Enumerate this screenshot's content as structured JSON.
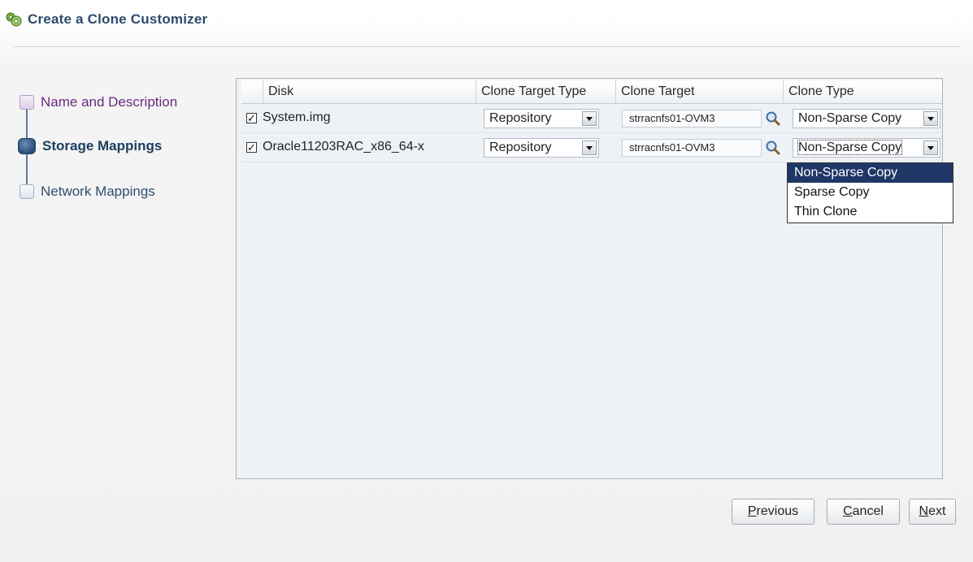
{
  "dialog": {
    "title": "Create a Clone Customizer"
  },
  "train": {
    "steps": [
      {
        "label": "Name and Description",
        "state": "visited"
      },
      {
        "label": "Storage Mappings",
        "state": "current"
      },
      {
        "label": "Network Mappings",
        "state": "unvisited"
      }
    ]
  },
  "table": {
    "columns": [
      "Disk",
      "Clone Target Type",
      "Clone Target",
      "Clone Type"
    ],
    "rows": [
      {
        "checked": true,
        "disk": "System.img",
        "target_type": "Repository",
        "target": "strracnfs01-OVM3",
        "clone_type": "Non-Sparse Copy"
      },
      {
        "checked": true,
        "disk": "Oracle11203RAC_x86_64-x",
        "target_type": "Repository",
        "target": "strracnfs01-OVM3",
        "clone_type": "Non-Sparse Copy"
      }
    ],
    "checkmark": "✓"
  },
  "clone_type_dropdown": {
    "options": [
      "Non-Sparse Copy",
      "Sparse Copy",
      "Thin Clone"
    ],
    "selected": "Non-Sparse Copy"
  },
  "buttons": {
    "previous": {
      "mnemonic": "P",
      "rest": "revious"
    },
    "cancel": {
      "mnemonic": "C",
      "rest": "ancel"
    },
    "next": {
      "mnemonic": "N",
      "rest": "ext"
    }
  },
  "icons": {
    "title": "clone-customizer-icon",
    "search": "search-magnifier-icon"
  },
  "colors": {
    "accent": "#1f3767",
    "current_step": "#1e3f62",
    "visited_step": "#6a2a7e"
  }
}
